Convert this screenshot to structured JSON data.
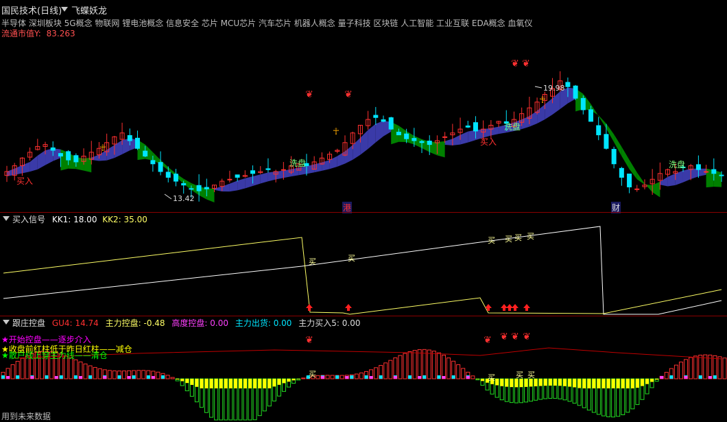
{
  "header": {
    "title": "国民技术(日线)",
    "indicator_name": "飞蝶妖龙",
    "concepts": "半导体 深圳板块 5G概念 物联网 锂电池概念 信息安全 芯片 MCU芯片 汽车芯片 机器人概念 量子科技 区块链 人工智能 工业互联 EDA概念 血氧仪",
    "market_cap_label": "流通市值Y:",
    "market_cap_value": "83.263"
  },
  "main": {
    "high_label": "19.98",
    "low_label": "13.42",
    "buy_label": "买入",
    "wash_label": "洗盘",
    "gang_label": "港",
    "cai_label": "财"
  },
  "panel2": {
    "name": "买入信号",
    "kk1_label": "KK1:",
    "kk1_value": "18.00",
    "kk2_label": "KK2:",
    "kk2_value": "35.00",
    "mai_label": "买"
  },
  "panel3": {
    "name": "跟庄控盘",
    "gu4_label": "GU4:",
    "gu4_value": "14.74",
    "zlkp_label": "主力控盘:",
    "zlkp_value": "-0.48",
    "gdkp_label": "高度控盘:",
    "gdkp_value": "0.00",
    "zlch_label": "主力出货:",
    "zlch_value": "0.00",
    "zlmr_label": "主力买入5:",
    "zlmr_value": "0.00",
    "legend": [
      {
        "text": "开始控盘——逐步介入",
        "color": "#ff00ff"
      },
      {
        "text": "收盘前红柱低于昨日红柱——减仓",
        "color": "#ffff00"
      },
      {
        "text": "散户线上穿主力线——清仓",
        "color": "#00ff00"
      }
    ]
  },
  "footer": {
    "note": "用到未来数据"
  },
  "colors": {
    "up": "#ff3030",
    "down": "#00e5ff",
    "ribbon_up": "#3a3aa8",
    "ribbon_down": "#008000",
    "line_white": "#ffffff",
    "line_yellow": "#ffff66",
    "gu4_line": "#c00000"
  },
  "chart_data": [
    {
      "type": "candlestick",
      "title": "国民技术(日线)",
      "ylim": [
        13.0,
        21.0
      ],
      "annotations": [
        {
          "text": "19.98",
          "kind": "high"
        },
        {
          "text": "13.42",
          "kind": "low"
        }
      ],
      "closes": [
        14.6,
        14.9,
        15.3,
        15.6,
        15.9,
        16.0,
        15.7,
        15.4,
        15.2,
        15.1,
        15.4,
        15.6,
        15.8,
        16.1,
        16.4,
        16.6,
        16.2,
        15.8,
        15.4,
        15.0,
        14.6,
        14.3,
        14.1,
        13.9,
        13.7,
        13.6,
        13.7,
        13.9,
        14.1,
        14.2,
        14.3,
        14.4,
        14.5,
        14.6,
        14.7,
        14.6,
        14.7,
        14.9,
        15.0,
        14.9,
        15.1,
        15.3,
        15.5,
        15.7,
        16.1,
        16.6,
        17.0,
        17.3,
        17.4,
        17.2,
        16.8,
        16.5,
        16.3,
        16.2,
        16.1,
        16.0,
        16.2,
        16.4,
        16.6,
        16.8,
        16.9,
        16.7,
        16.8,
        17.0,
        17.2,
        17.1,
        17.3,
        17.6,
        17.9,
        18.2,
        18.6,
        18.9,
        19.3,
        19.0,
        18.4,
        17.8,
        17.2,
        16.5,
        15.8,
        15.0,
        14.3,
        13.8,
        13.7,
        13.9,
        14.2,
        14.5,
        14.7,
        14.6,
        14.8,
        14.9,
        14.7,
        14.6,
        14.5,
        14.4
      ]
    },
    {
      "type": "line",
      "title": "买入信号",
      "series": [
        {
          "name": "KK1"
        },
        {
          "name": "KK2"
        }
      ],
      "ylim": [
        0,
        100
      ]
    },
    {
      "type": "bar",
      "title": "跟庄控盘",
      "series": [
        {
          "name": "GU4"
        },
        {
          "name": "主力控盘"
        }
      ],
      "ylim": [
        -40,
        20
      ]
    }
  ]
}
